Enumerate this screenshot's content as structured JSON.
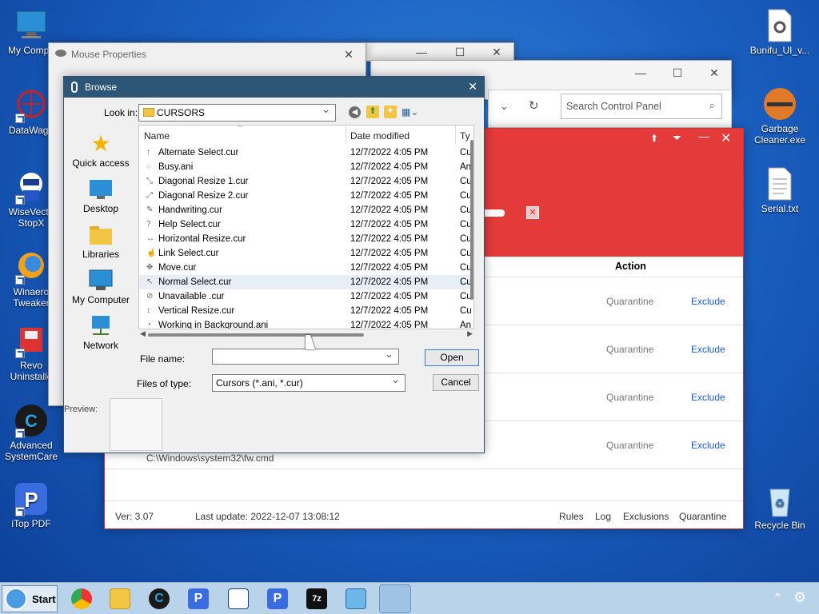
{
  "desktop": {
    "icons_left": [
      {
        "label": "My Compu"
      },
      {
        "label": "DataWago"
      },
      {
        "label": "WiseVecto StopX"
      },
      {
        "label": "Winaero Tweaker"
      },
      {
        "label": "Revo Uninstalle"
      },
      {
        "label": "Advanced SystemCare"
      },
      {
        "label": "iTop PDF"
      }
    ],
    "icons_right": [
      {
        "label": "Bunifu_UI_v..."
      },
      {
        "label": "Garbage Cleaner.exe"
      },
      {
        "label": "Serial.txt"
      },
      {
        "label": "Recycle Bin"
      }
    ]
  },
  "control_panel": {
    "search_placeholder": "Search Control Panel"
  },
  "fw_app": {
    "column_action": "Action",
    "rows": [
      {
        "q": "Quarantine",
        "e": "Exclude"
      },
      {
        "q": "Quarantine",
        "e": "Exclude"
      },
      {
        "q": "Quarantine",
        "e": "Exclude"
      },
      {
        "q": "Quarantine",
        "e": "Exclude"
      }
    ],
    "path": "C:\\Windows\\system32\\fw.cmd",
    "footer": {
      "version": "Ver: 3.07",
      "last_update": "Last update: 2022-12-07 13:08:12",
      "links": [
        "Rules",
        "Log",
        "Exclusions",
        "Quarantine"
      ]
    }
  },
  "mouse_props": {
    "title": "Mouse Properties"
  },
  "browse": {
    "title": "Browse",
    "look_in_label": "Look in:",
    "look_in_value": "CURSORS",
    "places": [
      "Quick access",
      "Desktop",
      "Libraries",
      "My Computer",
      "Network"
    ],
    "columns": {
      "name": "Name",
      "date": "Date modified",
      "type": "Ty"
    },
    "files": [
      {
        "name": "Alternate Select.cur",
        "date": "12/7/2022 4:05 PM",
        "type": "Cu",
        "icon": "↑"
      },
      {
        "name": "Busy.ani",
        "date": "12/7/2022 4:05 PM",
        "type": "An",
        "icon": "◌"
      },
      {
        "name": "Diagonal Resize 1.cur",
        "date": "12/7/2022 4:05 PM",
        "type": "Cu",
        "icon": "⤡"
      },
      {
        "name": "Diagonal Resize 2.cur",
        "date": "12/7/2022 4:05 PM",
        "type": "Cu",
        "icon": "⤢"
      },
      {
        "name": "Handwriting.cur",
        "date": "12/7/2022 4:05 PM",
        "type": "Cu",
        "icon": "✎"
      },
      {
        "name": "Help Select.cur",
        "date": "12/7/2022 4:05 PM",
        "type": "Cu",
        "icon": "?"
      },
      {
        "name": "Horizontal Resize.cur",
        "date": "12/7/2022 4:05 PM",
        "type": "Cu",
        "icon": "↔"
      },
      {
        "name": "Link Select.cur",
        "date": "12/7/2022 4:05 PM",
        "type": "Cu",
        "icon": "☝"
      },
      {
        "name": "Move.cur",
        "date": "12/7/2022 4:05 PM",
        "type": "Cu",
        "icon": "✥"
      },
      {
        "name": "Normal Select.cur",
        "date": "12/7/2022 4:05 PM",
        "type": "Cu",
        "icon": "↖"
      },
      {
        "name": "Unavailable .cur",
        "date": "12/7/2022 4:05 PM",
        "type": "Cu",
        "icon": "⊘"
      },
      {
        "name": "Vertical Resize.cur",
        "date": "12/7/2022 4:05 PM",
        "type": "Cu",
        "icon": "↕"
      },
      {
        "name": "Working in Background.ani",
        "date": "12/7/2022 4:05 PM",
        "type": "An",
        "icon": "◔"
      }
    ],
    "file_name_label": "File name:",
    "file_name_value": "",
    "files_of_type_label": "Files of type:",
    "files_of_type_value": "Cursors (*.ani, *.cur)",
    "open_label": "Open",
    "cancel_label": "Cancel",
    "preview_label": "Preview:"
  },
  "taskbar": {
    "start_label": "Start"
  },
  "colors": {
    "accent": "#e43a3a",
    "link": "#1f5cc8",
    "title_bar": "#2d5575"
  }
}
